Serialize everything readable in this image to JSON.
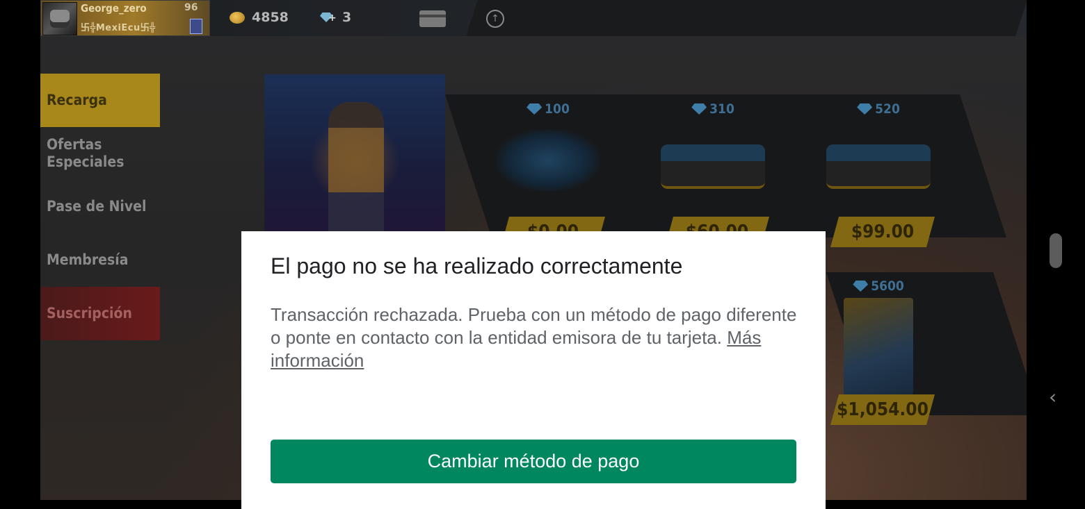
{
  "player": {
    "name": "George_zero",
    "guild": "卐╬MexiEcu卐╬",
    "level": "96"
  },
  "currency": {
    "coins": "4858",
    "diamonds": "3"
  },
  "sidebar": {
    "items": [
      {
        "label": "Recarga"
      },
      {
        "label": "Ofertas Especiales"
      },
      {
        "label": "Pase de Nivel"
      },
      {
        "label": "Membresía"
      },
      {
        "label": "Suscripción"
      }
    ]
  },
  "shop": {
    "packs": [
      {
        "amount": "100",
        "price": "$0.00"
      },
      {
        "amount": "310",
        "price": "$60.00"
      },
      {
        "amount": "520",
        "price": "$99.00"
      },
      {
        "amount": "5600",
        "price": "$1,054.00"
      }
    ]
  },
  "dialog": {
    "title": "El pago no se ha realizado correctamente",
    "body": "Transacción rechazada. Prueba con un método de pago diferente o ponte en contacto con la entidad emisora de tu tarjeta.",
    "link": "Más información",
    "button": "Cambiar método de pago"
  },
  "colors": {
    "accent_gold": "#a8881a",
    "button_green": "#01875f"
  }
}
